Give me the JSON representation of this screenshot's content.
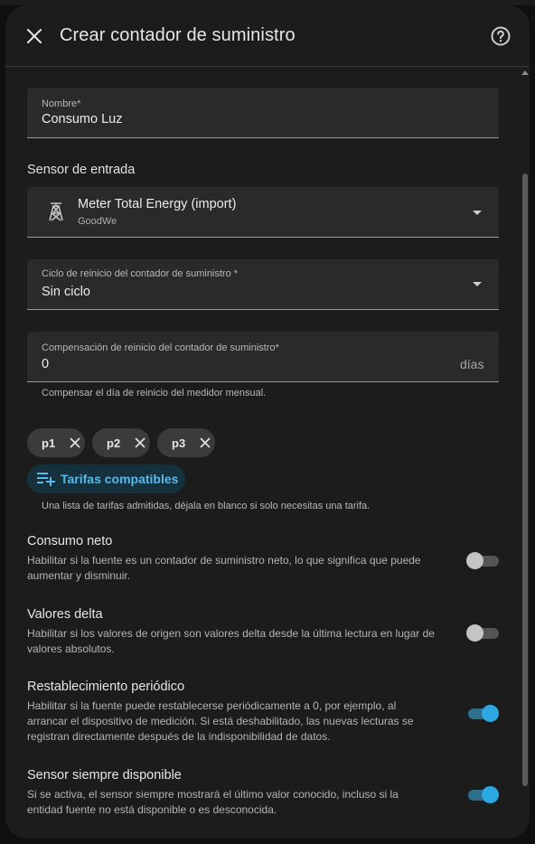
{
  "dialog": {
    "title": "Crear contador de suministro",
    "close_icon": "close-icon",
    "help_icon": "help-circle-icon"
  },
  "name_field": {
    "label": "Nombre*",
    "value": "Consumo Luz"
  },
  "input_sensor": {
    "section_label": "Sensor de entrada",
    "icon": "transmission-tower-icon",
    "entity_name": "Meter Total Energy (import)",
    "entity_source": "GoodWe"
  },
  "reset_cycle": {
    "label": "Ciclo de reinicio del contador de suministro *",
    "value": "Sin ciclo"
  },
  "reset_offset": {
    "label": "Compensación de reinicio del contador de suministro*",
    "value": "0",
    "suffix": "días",
    "helper": "Compensar el día de reinicio del medidor mensual."
  },
  "tariffs": {
    "chips": [
      {
        "label": "p1"
      },
      {
        "label": "p2"
      },
      {
        "label": "p3"
      }
    ],
    "add_label": "Tarifas compatibles",
    "helper": "Una lista de tarifas admitidas, déjala en blanco si solo necesitas una tarifa."
  },
  "options": [
    {
      "title": "Consumo neto",
      "desc_lines": [
        "Habilitar si la fuente es un contador de suministro neto, lo que significa que puede",
        "aumentar y disminuir."
      ],
      "enabled": false
    },
    {
      "title": "Valores delta",
      "desc_lines": [
        "Habilitar si los valores de origen son valores delta desde la última lectura en lugar de",
        "valores absolutos."
      ],
      "enabled": false
    },
    {
      "title": "Restablecimiento periódico",
      "desc_lines": [
        "Habilitar si la fuente puede restablecerse periódicamente a 0, por ejemplo, al",
        "arrancar el dispositivo de medición. Si está deshabilitado, las nuevas lecturas se",
        "registran directamente después de la indisponibilidad de datos."
      ],
      "enabled": true
    },
    {
      "title": "Sensor siempre disponible",
      "desc_lines": [
        "Si se activa, el sensor siempre mostrará el último valor conocido, incluso si la",
        "entidad fuente no está disponible o es desconocida."
      ],
      "enabled": true
    }
  ],
  "colors": {
    "accent": "#2ea8e0",
    "surface": "#1c1c1c",
    "field": "#2a2a2a"
  }
}
